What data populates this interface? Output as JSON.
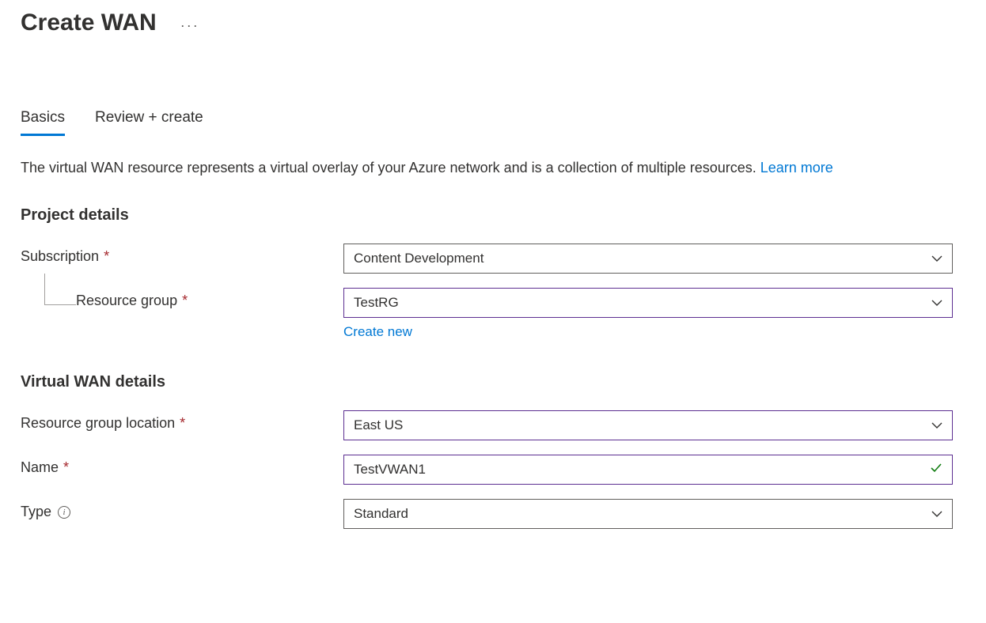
{
  "header": {
    "title": "Create WAN"
  },
  "tabs": {
    "basics": "Basics",
    "review_create": "Review + create"
  },
  "description": {
    "text": "The virtual WAN resource represents a virtual overlay of your Azure network and is a collection of multiple resources. ",
    "learn_more": "Learn more"
  },
  "sections": {
    "project_details": {
      "title": "Project details",
      "fields": {
        "subscription": {
          "label": "Subscription",
          "value": "Content Development"
        },
        "resource_group": {
          "label": "Resource group",
          "value": "TestRG",
          "create_new": "Create new"
        }
      }
    },
    "vwan_details": {
      "title": "Virtual WAN details",
      "fields": {
        "location": {
          "label": "Resource group location",
          "value": "East US"
        },
        "name": {
          "label": "Name",
          "value": "TestVWAN1"
        },
        "type": {
          "label": "Type",
          "value": "Standard"
        }
      }
    }
  }
}
